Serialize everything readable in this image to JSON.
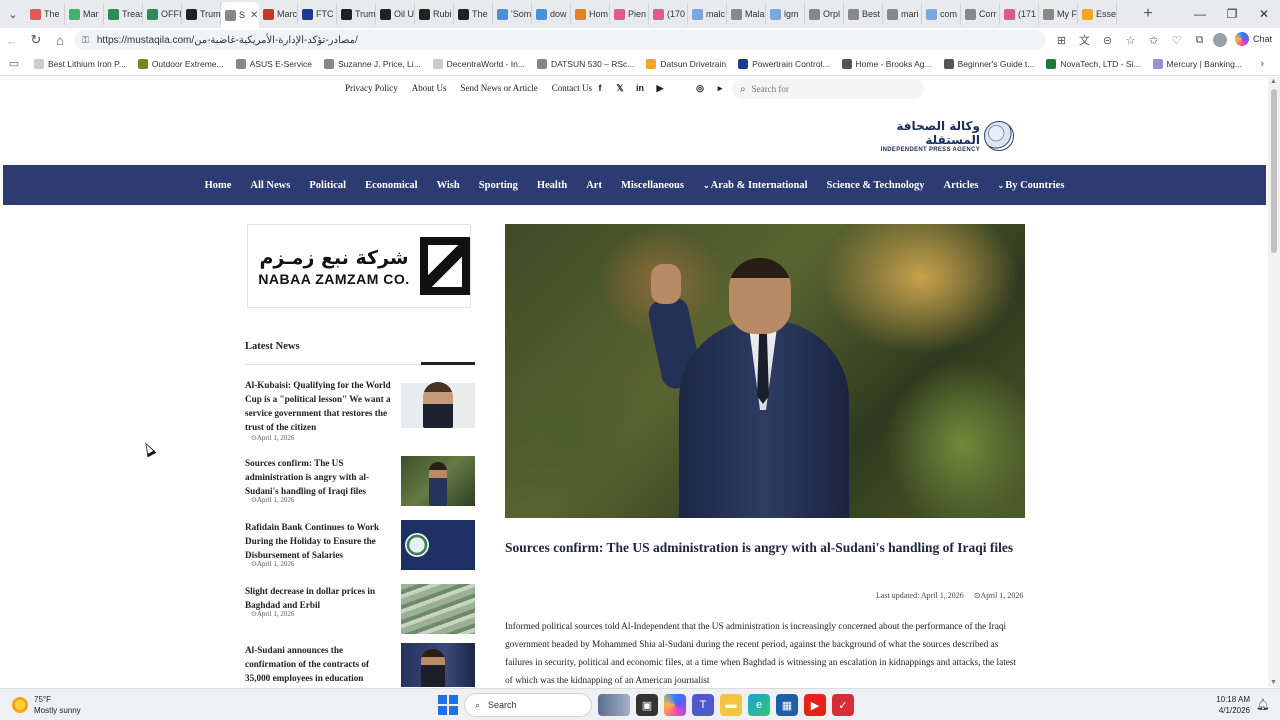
{
  "browser": {
    "tabs": [
      {
        "label": "The",
        "color": "#e05a5a"
      },
      {
        "label": "Mar",
        "color": "#3cb371"
      },
      {
        "label": "Treas",
        "color": "#2e8b57"
      },
      {
        "label": "OFFI",
        "color": "#2e8b57"
      },
      {
        "label": "Trum",
        "color": "#222222"
      },
      {
        "label": "S",
        "color": "#888888",
        "active": true
      },
      {
        "label": "Marc",
        "color": "#c0392b"
      },
      {
        "label": "FTC E",
        "color": "#1f3a93"
      },
      {
        "label": "Trum",
        "color": "#222222"
      },
      {
        "label": "Oil U",
        "color": "#222222"
      },
      {
        "label": "Rubi",
        "color": "#222222"
      },
      {
        "label": "The",
        "color": "#222222"
      },
      {
        "label": "'Som",
        "color": "#4a90d9"
      },
      {
        "label": "dow",
        "color": "#4a90d9"
      },
      {
        "label": "Hom",
        "color": "#e67e22"
      },
      {
        "label": "Pien",
        "color": "#e05a8a"
      },
      {
        "label": "(170",
        "color": "#e05a8a"
      },
      {
        "label": "malc",
        "color": "#7aa7e0"
      },
      {
        "label": "Mala",
        "color": "#888888"
      },
      {
        "label": "lgm",
        "color": "#7aa7e0"
      },
      {
        "label": "Orpl",
        "color": "#888888"
      },
      {
        "label": "Best",
        "color": "#888888"
      },
      {
        "label": "mari",
        "color": "#888888"
      },
      {
        "label": "com",
        "color": "#7aa7e0"
      },
      {
        "label": "Corr",
        "color": "#888888"
      },
      {
        "label": "(171",
        "color": "#e05a8a"
      },
      {
        "label": "My F",
        "color": "#888888"
      },
      {
        "label": "Esse",
        "color": "#f5a623"
      }
    ],
    "url": "https://mustaqila.com/مصادر-تؤكد-الإدارة-الأمريكية-غاضبة-من/",
    "copilot_label": "Chat",
    "bookmarks": [
      {
        "label": "Best Lithium Iron P...",
        "color": "#cccccc"
      },
      {
        "label": "Outdoor Extreme...",
        "color": "#6b8e23"
      },
      {
        "label": "ASUS E-Service",
        "color": "#888888"
      },
      {
        "label": "Suzanne J. Price, Li...",
        "color": "#888888"
      },
      {
        "label": "DecentraWorld - In...",
        "color": "#cccccc"
      },
      {
        "label": "DATSUN 530 – RSc...",
        "color": "#888888"
      },
      {
        "label": "Datsun Drivetrain",
        "color": "#f5a623"
      },
      {
        "label": "Powertrain Control...",
        "color": "#1f3a93"
      },
      {
        "label": "Home - Brooks Ag...",
        "color": "#555555"
      },
      {
        "label": "Beginner's Guide t...",
        "color": "#555555"
      },
      {
        "label": "NovaTech, LTD - Si...",
        "color": "#1f7a3a"
      },
      {
        "label": "Mercury | Banking...",
        "color": "#9b8fd6"
      }
    ]
  },
  "site": {
    "top_links": [
      "Privacy Policy",
      "About Us",
      "Send News or Article",
      "Contact Us"
    ],
    "search_placeholder": "Search for",
    "logo_arabic": "وكالة الصحافة المستقلة",
    "logo_english": "INDEPENDENT PRESS AGENCY",
    "nav": [
      {
        "label": "Home"
      },
      {
        "label": "All News"
      },
      {
        "label": "Political"
      },
      {
        "label": "Economical"
      },
      {
        "label": "Wish"
      },
      {
        "label": "Sporting"
      },
      {
        "label": "Health"
      },
      {
        "label": "Art"
      },
      {
        "label": "Miscellaneous"
      },
      {
        "label": "Arab & International",
        "caret": true
      },
      {
        "label": "Science & Technology"
      },
      {
        "label": "Articles"
      },
      {
        "label": "By Countries",
        "caret": true
      }
    ]
  },
  "sidebar": {
    "ad_arabic": "شركة نبع زمـزم",
    "ad_english": "NABAA ZAMZAM CO.",
    "latest_title": "Latest News",
    "news": [
      {
        "title": "Al-Kubaisi: Qualifying for the World Cup is a \"political lesson\" We want a service government that restores the trust of the citizen",
        "date": "April 1, 2026",
        "thumb": "thumb-person1"
      },
      {
        "title": "Sources confirm: The US administration is angry with al-Sudani's handling of Iraqi files",
        "date": "April 1, 2026",
        "thumb": "thumb-sudani"
      },
      {
        "title": "Rafidain Bank Continues to Work During the Holiday to Ensure the Disbursement of Salaries",
        "date": "April 1, 2026",
        "thumb": "thumb-bank"
      },
      {
        "title": "Slight decrease in dollar prices in Baghdad and Erbil",
        "date": "April 1, 2026",
        "thumb": "thumb-dollars"
      },
      {
        "title": "Al-Sudani announces the confirmation of the contracts of 35,000 employees in education",
        "date": "",
        "thumb": "thumb-sudani2"
      }
    ]
  },
  "article": {
    "headline": "Sources confirm: The US administration is angry with al-Sudani's handling of Iraqi files",
    "last_updated": "Last updated: April 1, 2026",
    "published": "April 1, 2026",
    "body": "Informed political sources told Al-Independent that the US administration is increasingly concerned about the performance of the Iraqi government headed by Mohammed Shia al-Sudani during the recent period, against the background of what the sources described as failures in security, political and economic files, at a time when Baghdad is witnessing an escalation in kidnappings and attacks, the latest of which was the kidnapping of an American journalist"
  },
  "taskbar": {
    "temperature": "75°F",
    "weather": "Mostly sunny",
    "search_label": "Search",
    "time": "10:18 AM",
    "date": "4/1/2026"
  },
  "colors": {
    "nav_bg": "#2d3b73",
    "headline": "#1d2540"
  }
}
